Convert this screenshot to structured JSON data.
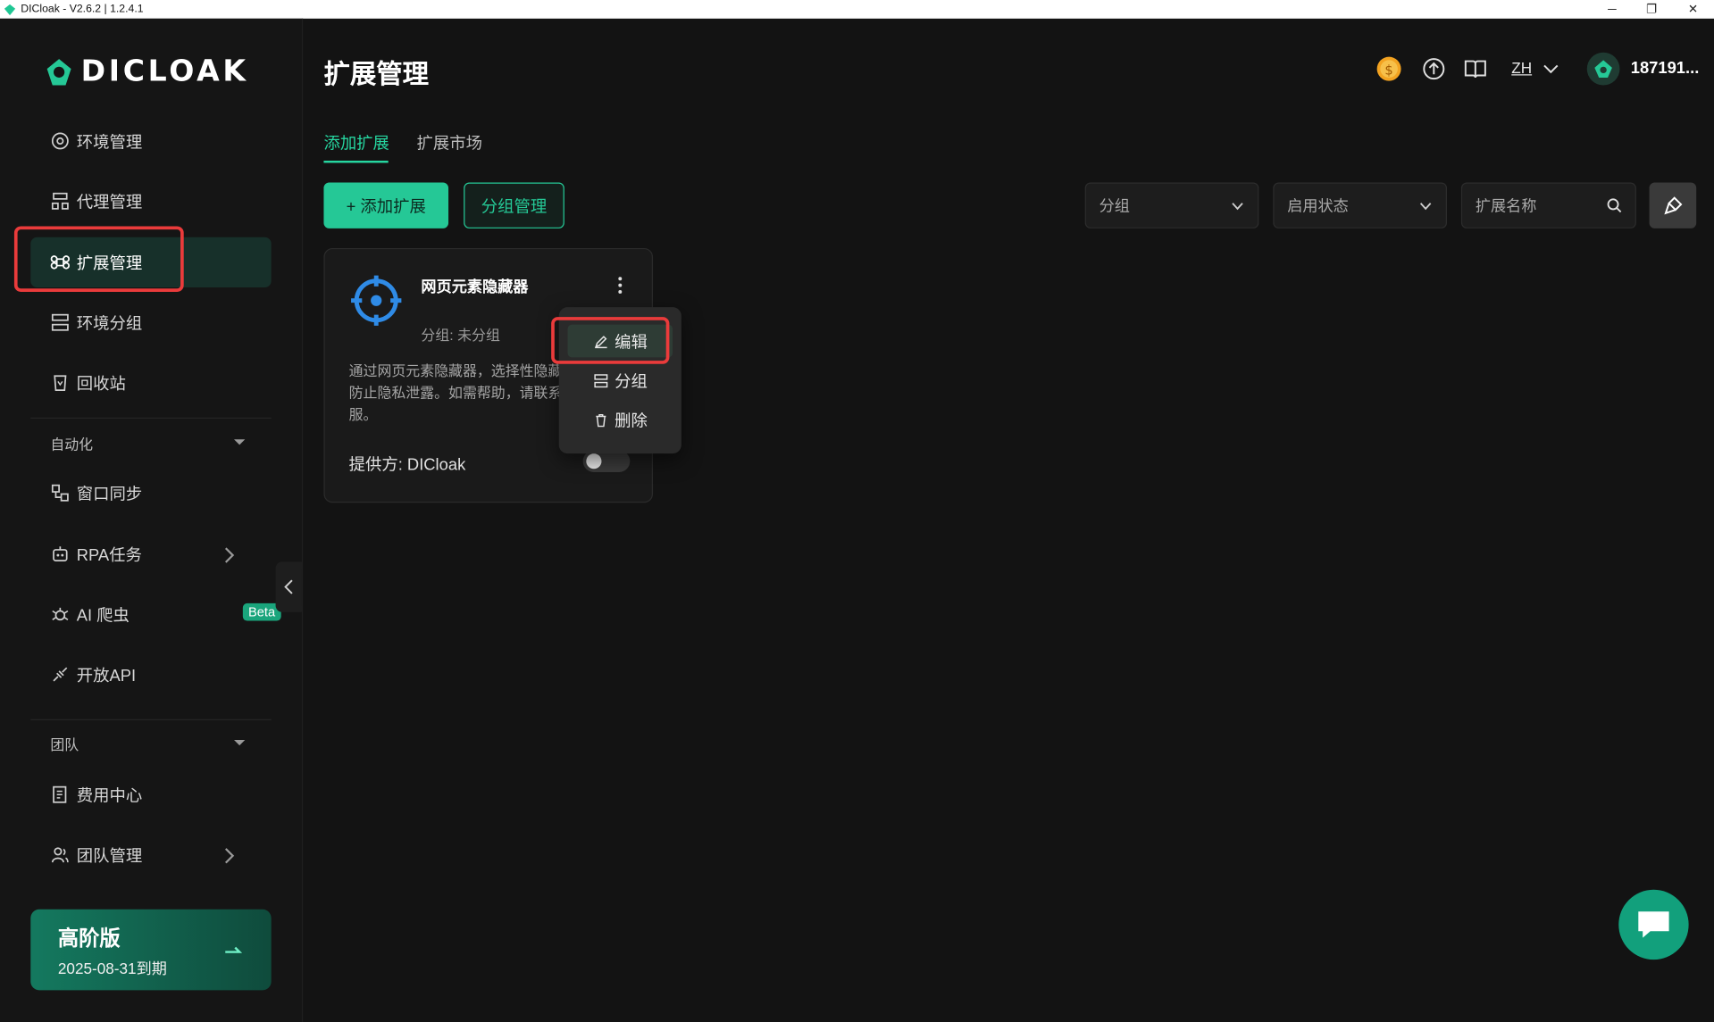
{
  "window": {
    "title": "DICloak - V2.6.2 | 1.2.4.1",
    "minimize": "─",
    "restore": "❐",
    "close": "✕"
  },
  "brand": {
    "logo_text": "DICLOAK",
    "accent": "#25c896"
  },
  "sidebar": {
    "items": [
      {
        "label": "环境管理",
        "icon": "chrome-icon"
      },
      {
        "label": "代理管理",
        "icon": "proxy-icon"
      },
      {
        "label": "扩展管理",
        "icon": "command-icon",
        "active": true
      },
      {
        "label": "环境分组",
        "icon": "group-icon"
      },
      {
        "label": "回收站",
        "icon": "recycle-icon"
      }
    ],
    "automation_header": "自动化",
    "automation_items": [
      {
        "label": "窗口同步",
        "icon": "window-sync-icon"
      },
      {
        "label": "RPA任务",
        "icon": "robot-icon"
      },
      {
        "label": "AI 爬虫",
        "icon": "spider-icon",
        "badge": "Beta"
      },
      {
        "label": "开放API",
        "icon": "api-icon"
      }
    ],
    "team_header": "团队",
    "team_items": [
      {
        "label": "费用中心",
        "icon": "billing-icon"
      },
      {
        "label": "团队管理",
        "icon": "team-icon"
      }
    ],
    "plan": {
      "name": "高阶版",
      "expiry": "2025-08-31到期"
    }
  },
  "header": {
    "title": "扩展管理",
    "language": "ZH",
    "username": "187191..."
  },
  "tabs": [
    {
      "label": "添加扩展",
      "active": true
    },
    {
      "label": "扩展市场",
      "active": false
    }
  ],
  "toolbar": {
    "add_label": "+ 添加扩展",
    "group_manage_label": "分组管理",
    "group_filter": "分组",
    "status_filter": "启用状态",
    "search_placeholder": "扩展名称"
  },
  "extension_card": {
    "name": "网页元素隐藏器",
    "group": "分组: 未分组",
    "description": "通过网页元素隐藏器，选择性隐藏，防止隐私泄露。如需帮助，请联系客服。",
    "provider": "提供方: DICloak",
    "enabled": false
  },
  "context_menu": {
    "items": [
      {
        "label": "编辑",
        "icon": "edit-icon"
      },
      {
        "label": "分组",
        "icon": "group-icon"
      },
      {
        "label": "删除",
        "icon": "trash-icon"
      }
    ]
  }
}
